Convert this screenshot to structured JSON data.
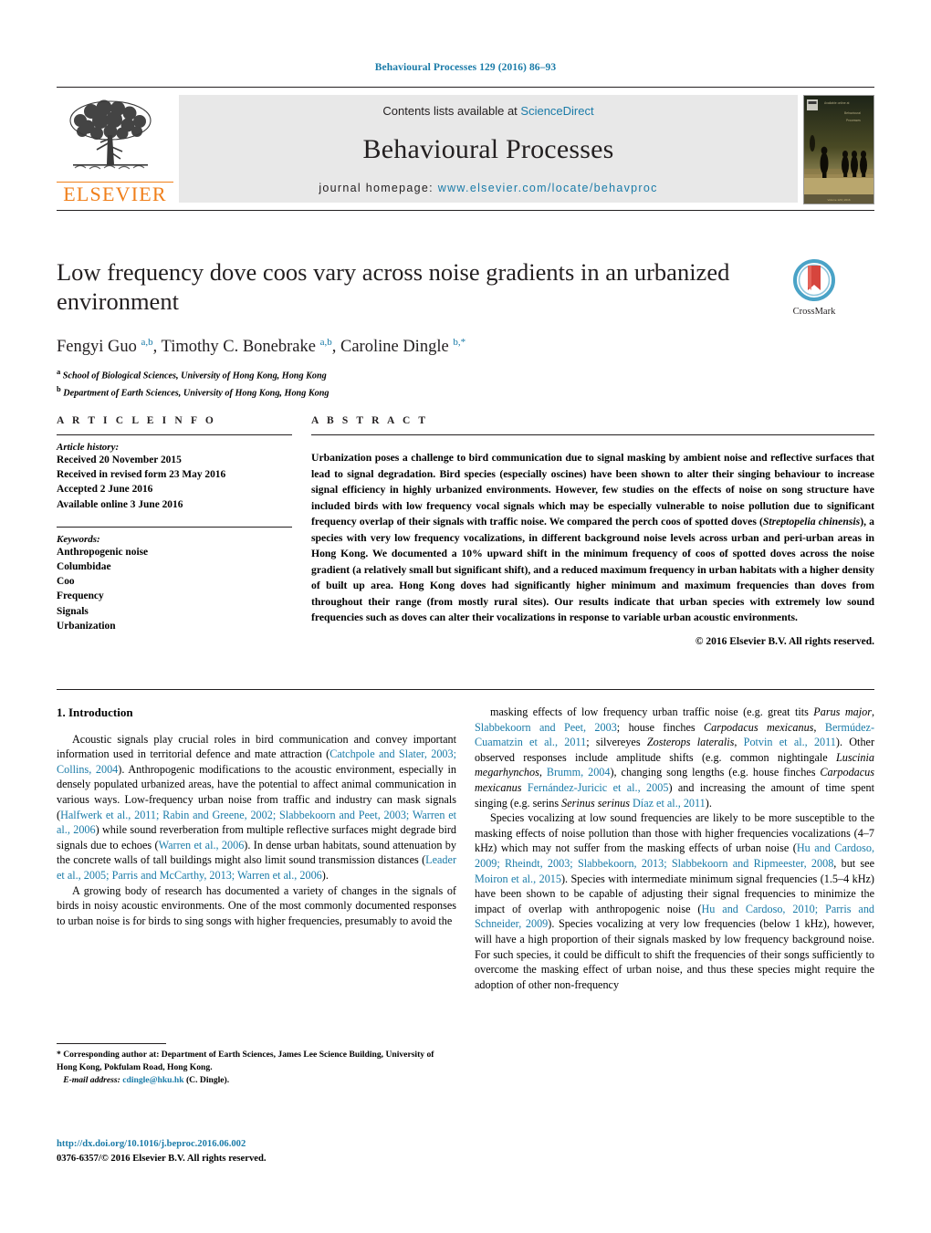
{
  "running_head": "Behavioural Processes 129 (2016) 86–93",
  "masthead": {
    "contents_prefix": "Contents lists available at ",
    "sciencedirect": "ScienceDirect",
    "journal_title": "Behavioural Processes",
    "homepage_prefix": "journal homepage:",
    "homepage_url": "www.elsevier.com/locate/behavproc",
    "publisher": "ELSEVIER",
    "logo_icon": "elsevier-tree-logo",
    "cover_icon": "journal-cover-thumbnail"
  },
  "article": {
    "title": "Low frequency dove coos vary across noise gradients in an urbanized environment",
    "crossmark_label": "CrossMark",
    "crossmark_icon": "crossmark-logo",
    "authors_html": "Fengyi Guo <sup>a,b</sup>, Timothy C. Bonebrake <sup>a,b</sup>, Caroline Dingle <sup>b,</sup><sup>*</sup>",
    "affiliation_a": "School of Biological Sciences, University of Hong Kong, Hong Kong",
    "affiliation_b": "Department of Earth Sciences, University of Hong Kong, Hong Kong"
  },
  "info": {
    "heading": "A R T I C L E   I N F O",
    "history_label": "Article history:",
    "history": [
      "Received 20 November 2015",
      "Received in revised form 23 May 2016",
      "Accepted 2 June 2016",
      "Available online 3 June 2016"
    ],
    "keywords_label": "Keywords:",
    "keywords": [
      "Anthropogenic noise",
      "Columbidae",
      "Coo",
      "Frequency",
      "Signals",
      "Urbanization"
    ]
  },
  "abstract": {
    "heading": "A B S T R A C T",
    "body_html": "Urbanization poses a challenge to bird communication due to signal masking by ambient noise and reflective surfaces that lead to signal degradation. Bird species (especially oscines) have been shown to alter their singing behaviour to increase signal efficiency in highly urbanized environments. However, few studies on the effects of noise on song structure have included birds with low frequency vocal signals which may be especially vulnerable to noise pollution due to significant frequency overlap of their signals with traffic noise. We compared the perch coos of spotted doves (<i>Streptopelia chinensis</i>), a species with very low frequency vocalizations, in different background noise levels across urban and peri-urban areas in Hong Kong. We documented a 10% upward shift in the minimum frequency of coos of spotted doves across the noise gradient (a relatively small but significant shift), and a reduced maximum frequency in urban habitats with a higher density of built up area. Hong Kong doves had significantly higher minimum and maximum frequencies than doves from throughout their range (from mostly rural sites). Our results indicate that urban species with extremely low sound frequencies such as doves can alter their vocalizations in response to variable urban acoustic environments.",
    "copyright": "© 2016 Elsevier B.V. All rights reserved."
  },
  "body": {
    "section_heading": "1.  Introduction",
    "left_paragraphs_html": [
      "Acoustic signals play crucial roles in bird communication and convey important information used in territorial defence and mate attraction (<span class=\"cite\">Catchpole and Slater, 2003; Collins, 2004</span>). Anthropogenic modifications to the acoustic environment, especially in densely populated urbanized areas, have the potential to affect animal communication in various ways. Low-frequency urban noise from traffic and industry can mask signals (<span class=\"cite\">Halfwerk et al., 2011; Rabin and Greene, 2002; Slabbekoorn and Peet, 2003; Warren et al., 2006</span>) while sound reverberation from multiple reflective surfaces might degrade bird signals due to echoes (<span class=\"cite\">Warren et al., 2006</span>). In dense urban habitats, sound attenuation by the concrete walls of tall buildings might also limit sound transmission distances (<span class=\"cite\">Leader et al., 2005; Parris and McCarthy, 2013; Warren et al., 2006</span>).",
      "A growing body of research has documented a variety of changes in the signals of birds in noisy acoustic environments. One of the most commonly documented responses to urban noise is for birds to sing songs with higher frequencies, presumably to avoid the"
    ],
    "right_paragraphs_html": [
      "masking effects of low frequency urban traffic noise (e.g. great tits <i>Parus major</i>, <span class=\"cite\">Slabbekoorn and Peet, 2003</span>; house finches <i>Carpodacus mexicanus</i>, <span class=\"cite\">Bermúdez-Cuamatzin et al., 2011</span>; silvereyes <i>Zosterops lateralis</i>, <span class=\"cite\">Potvin et al., 2011</span>). Other observed responses include amplitude shifts (e.g. common nightingale <i>Luscinia megarhynchos</i>, <span class=\"cite\">Brumm, 2004</span>), changing song lengths (e.g. house finches <i>Carpodacus mexicanus</i> <span class=\"cite\">Fernández-Juricic et al., 2005</span>) and increasing the amount of time spent singing (e.g. serins <i>Serinus serinus</i> <span class=\"cite\">Díaz et al., 2011</span>).",
      "Species vocalizing at low sound frequencies are likely to be more susceptible to the masking effects of noise pollution than those with higher frequencies vocalizations (4–7 kHz) which may not suffer from the masking effects of urban noise (<span class=\"cite\">Hu and Cardoso, 2009; Rheindt, 2003; Slabbekoorn, 2013; Slabbekoorn and Ripmeester, 2008</span>, but see <span class=\"cite\">Moiron et al., 2015</span>). Species with intermediate minimum signal frequencies (1.5–4 kHz) have been shown to be capable of adjusting their signal frequencies to minimize the impact of overlap with anthropogenic noise (<span class=\"cite\">Hu and Cardoso, 2010; Parris and Schneider, 2009</span>). Species vocalizing at very low frequencies (below 1 kHz), however, will have a high proportion of their signals masked by low frequency background noise. For such species, it could be difficult to shift the frequencies of their songs sufficiently to overcome the masking effect of urban noise, and thus these species might require the adoption of other non-frequency"
    ]
  },
  "footnote": {
    "corresponding_html": "* Corresponding author at: Department of Earth Sciences, James Lee Science Building, University of Hong Kong, Pokfulam Road, Hong Kong.",
    "email_label": "E-mail address:",
    "email": "cdingle@hku.hk",
    "email_suffix": "(C. Dingle)."
  },
  "doi_block": {
    "doi_url": "http://dx.doi.org/10.1016/j.beproc.2016.06.002",
    "issn_line": "0376-6357/© 2016 Elsevier B.V. All rights reserved."
  },
  "colors": {
    "link_blue": "#1a7ba8",
    "elsevier_orange": "#f07f1a",
    "mast_gray": "#e8e8e8"
  }
}
